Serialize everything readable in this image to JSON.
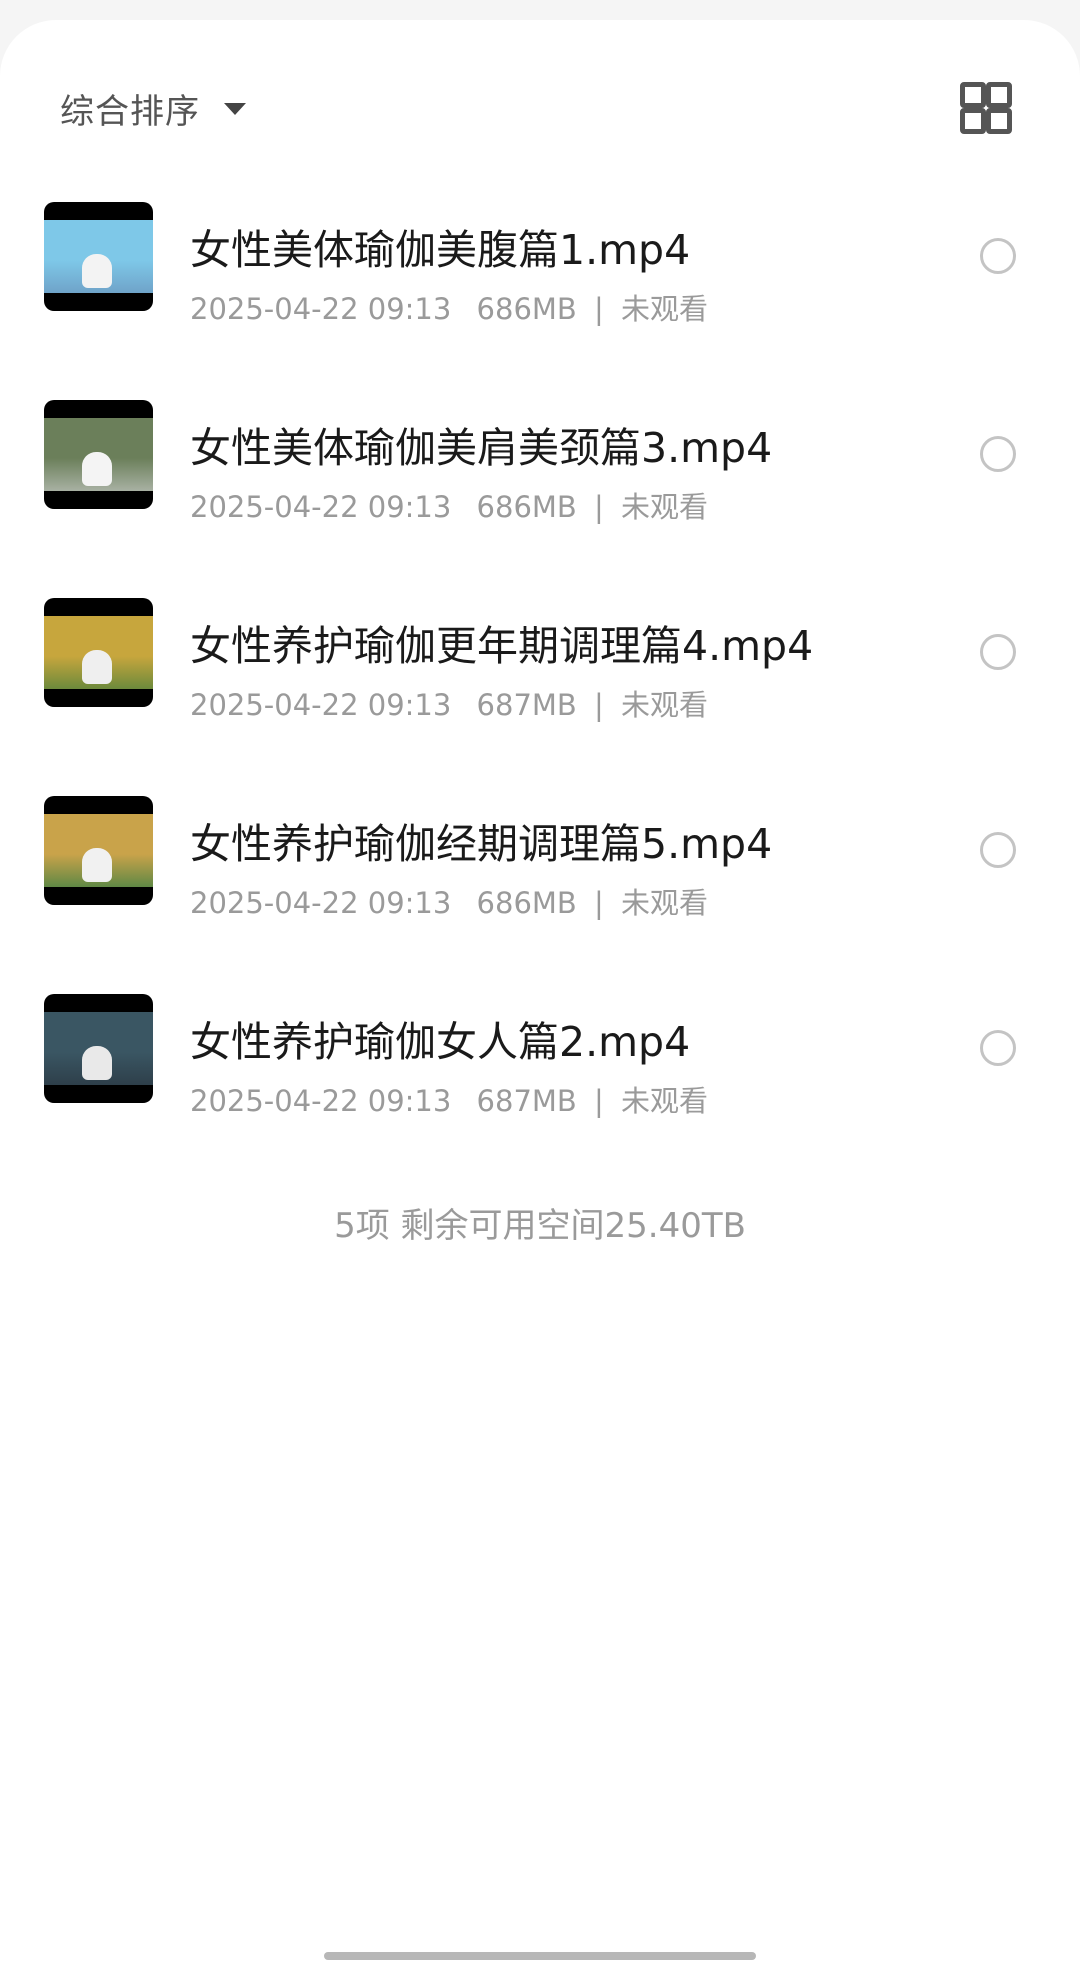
{
  "toolbar": {
    "sort_label": "综合排序",
    "grid_icon": "grid-view-icon"
  },
  "files": [
    {
      "title": "女性美体瑜伽美腹篇1.mp4",
      "date": "2025-04-22 09:13",
      "size": "686MB",
      "separator": "|",
      "status": "未观看",
      "thumb_colors": {
        "sky": "#7ec8e8",
        "ground": "#6fa3c9",
        "figure": "#f3f3f3"
      }
    },
    {
      "title": "女性美体瑜伽美肩美颈篇3.mp4",
      "date": "2025-04-22 09:13",
      "size": "686MB",
      "separator": "|",
      "status": "未观看",
      "thumb_colors": {
        "sky": "#6b7f5a",
        "ground": "#a8b1a3",
        "figure": "#f4f4f4"
      }
    },
    {
      "title": "女性养护瑜伽更年期调理篇4.mp4",
      "date": "2025-04-22 09:13",
      "size": "687MB",
      "separator": "|",
      "status": "未观看",
      "thumb_colors": {
        "sky": "#c7a63d",
        "ground": "#6c8a3c",
        "figure": "#efefef"
      }
    },
    {
      "title": "女性养护瑜伽经期调理篇5.mp4",
      "date": "2025-04-22 09:13",
      "size": "686MB",
      "separator": "|",
      "status": "未观看",
      "thumb_colors": {
        "sky": "#c9a34a",
        "ground": "#5f8845",
        "figure": "#f1f1f1"
      }
    },
    {
      "title": "女性养护瑜伽女人篇2.mp4",
      "date": "2025-04-22 09:13",
      "size": "687MB",
      "separator": "|",
      "status": "未观看",
      "thumb_colors": {
        "sky": "#3a5663",
        "ground": "#2e3f4a",
        "figure": "#e9e9e9"
      }
    }
  ],
  "footer": {
    "summary": "5项 剩余可用空间25.40TB"
  },
  "colors": {
    "title_text": "#1a1a1a",
    "meta_text": "#9a9a9a",
    "radio_border": "#c4c4c4"
  }
}
